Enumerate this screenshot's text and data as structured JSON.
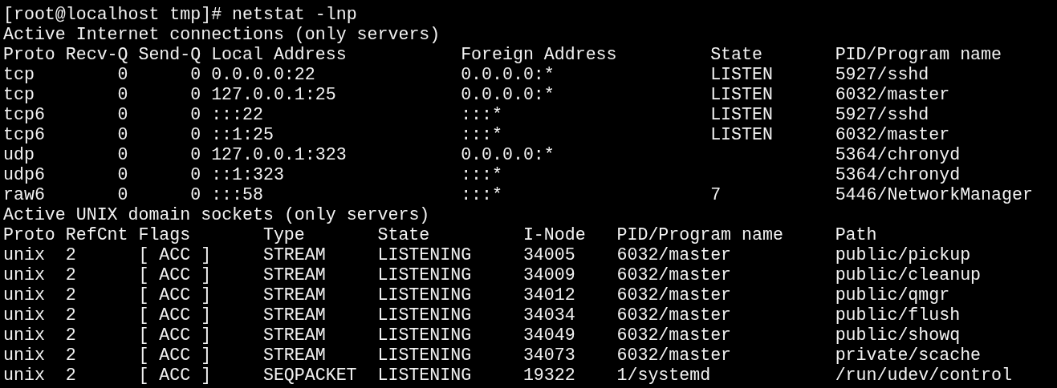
{
  "command_line": "[root@localhost tmp]# netstat -lnp",
  "internet_section": {
    "heading": "Active Internet connections (only servers)",
    "columns": [
      "Proto",
      "Recv-Q",
      "Send-Q",
      "Local Address",
      "Foreign Address",
      "State",
      "PID/Program name"
    ],
    "rows": [
      [
        "tcp",
        "0",
        "0",
        "0.0.0.0:22",
        "0.0.0.0:*",
        "LISTEN",
        "5927/sshd"
      ],
      [
        "tcp",
        "0",
        "0",
        "127.0.0.1:25",
        "0.0.0.0:*",
        "LISTEN",
        "6032/master"
      ],
      [
        "tcp6",
        "0",
        "0",
        ":::22",
        ":::*",
        "LISTEN",
        "5927/sshd"
      ],
      [
        "tcp6",
        "0",
        "0",
        "::1:25",
        ":::*",
        "LISTEN",
        "6032/master"
      ],
      [
        "udp",
        "0",
        "0",
        "127.0.0.1:323",
        "0.0.0.0:*",
        "",
        "5364/chronyd"
      ],
      [
        "udp6",
        "0",
        "0",
        "::1:323",
        ":::*",
        "",
        "5364/chronyd"
      ],
      [
        "raw6",
        "0",
        "0",
        ":::58",
        ":::*",
        "7",
        "5446/NetworkManager"
      ]
    ]
  },
  "unix_section": {
    "heading": "Active UNIX domain sockets (only servers)",
    "columns": [
      "Proto",
      "RefCnt",
      "Flags",
      "Type",
      "State",
      "I-Node",
      "PID/Program name",
      "Path"
    ],
    "rows": [
      [
        "unix",
        "2",
        "[ ACC ]",
        "STREAM",
        "LISTENING",
        "34005",
        "6032/master",
        "public/pickup"
      ],
      [
        "unix",
        "2",
        "[ ACC ]",
        "STREAM",
        "LISTENING",
        "34009",
        "6032/master",
        "public/cleanup"
      ],
      [
        "unix",
        "2",
        "[ ACC ]",
        "STREAM",
        "LISTENING",
        "34012",
        "6032/master",
        "public/qmgr"
      ],
      [
        "unix",
        "2",
        "[ ACC ]",
        "STREAM",
        "LISTENING",
        "34034",
        "6032/master",
        "public/flush"
      ],
      [
        "unix",
        "2",
        "[ ACC ]",
        "STREAM",
        "LISTENING",
        "34049",
        "6032/master",
        "public/showq"
      ],
      [
        "unix",
        "2",
        "[ ACC ]",
        "STREAM",
        "LISTENING",
        "34073",
        "6032/master",
        "private/scache"
      ],
      [
        "unix",
        "2",
        "[ ACC ]",
        "SEQPACKET",
        "LISTENING",
        "19322",
        "1/systemd",
        "/run/udev/control"
      ]
    ]
  }
}
